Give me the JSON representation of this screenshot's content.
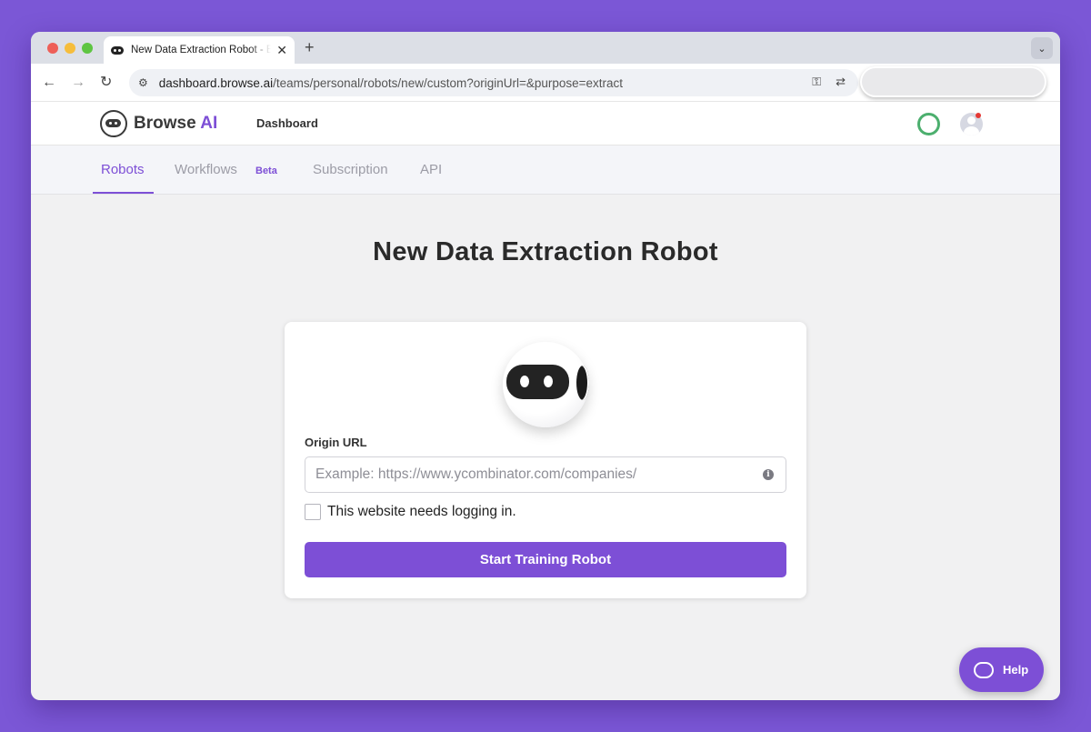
{
  "browser": {
    "tab_title": "New Data Extraction Robot - Browse AI",
    "tab_close": "✕",
    "new_tab": "+",
    "tab_menu": "⌄",
    "url_host": "dashboard.browse.ai",
    "url_path": "/teams/personal/robots/new/custom?originUrl=&purpose=extract"
  },
  "header": {
    "brand_name": "Browse",
    "brand_suffix": "AI",
    "nav_dashboard": "Dashboard"
  },
  "subnav": {
    "items": [
      {
        "label": "Robots",
        "active": true
      },
      {
        "label": "Workflows",
        "active": false
      },
      {
        "label": "Subscription",
        "active": false
      },
      {
        "label": "API",
        "active": false
      }
    ],
    "beta_badge": "Beta"
  },
  "main": {
    "title": "New Data Extraction Robot",
    "origin_label": "Origin URL",
    "origin_placeholder": "Example: https://www.ycombinator.com/companies/",
    "origin_value": "",
    "login_checkbox_label": "This website needs logging in.",
    "login_checked": false,
    "start_button": "Start Training Robot"
  },
  "help": {
    "label": "Help"
  },
  "colors": {
    "accent": "#7d4fd6",
    "background": "#7b57d6",
    "status_ring": "#4caf6e"
  }
}
